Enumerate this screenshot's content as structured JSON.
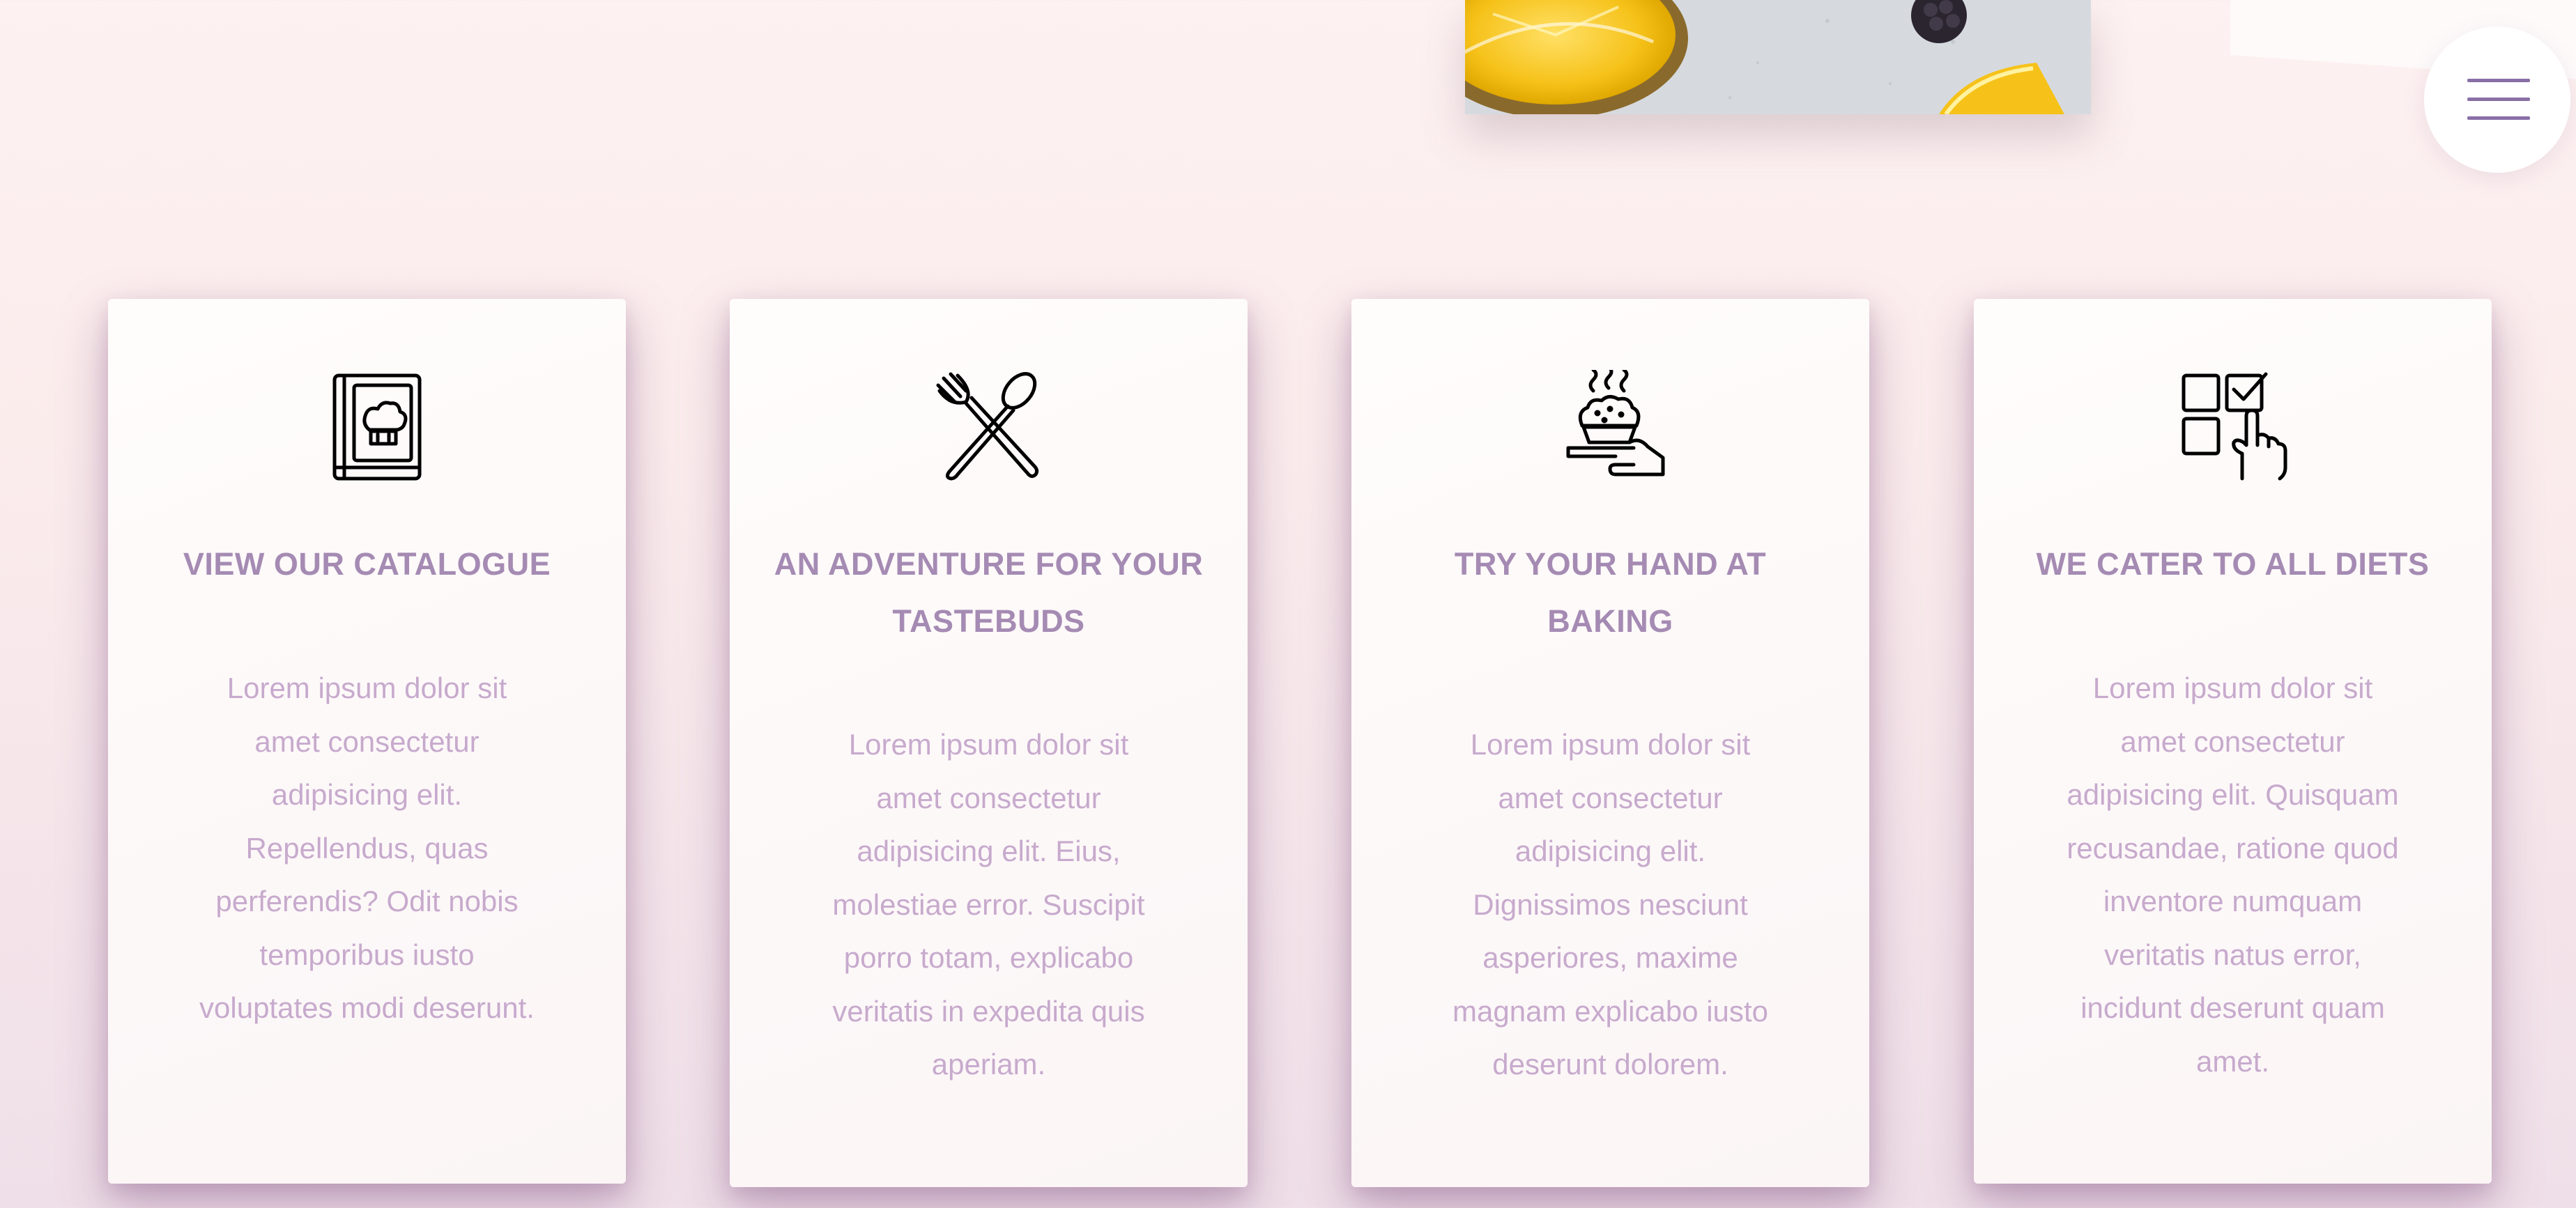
{
  "header": {
    "menu_icon": "hamburger-menu-icon",
    "accent_color": "#8a6fa6"
  },
  "hero": {
    "image_desc": "food-photo-fragment"
  },
  "features": [
    {
      "icon": "chef-book-icon",
      "title": "VIEW OUR CATALOGUE",
      "description": "Lorem ipsum dolor sit amet consectetur adipisicing elit. Repellendus, quas perferendis? Odit nobis temporibus iusto voluptates modi deserunt."
    },
    {
      "icon": "fork-spoon-icon",
      "title": "AN ADVENTURE FOR YOUR TASTEBUDS",
      "description": "Lorem ipsum dolor sit amet consectetur adipisicing elit. Eius, molestiae error. Suscipit porro totam, explicabo veritatis in expedita quis aperiam."
    },
    {
      "icon": "baking-muffin-icon",
      "title": "TRY YOUR HAND AT BAKING",
      "description": "Lorem ipsum dolor sit amet consectetur adipisicing elit. Dignissimos nesciunt asperiores, maxime magnam explicabo iusto deserunt dolorem."
    },
    {
      "icon": "diet-checklist-icon",
      "title": "WE CATER TO ALL DIETS",
      "description": "Lorem ipsum dolor sit amet consectetur adipisicing elit. Quisquam recusandae, ratione quod inventore numquam veritatis natus error, incidunt deserunt quam amet."
    }
  ],
  "colors": {
    "title": "#a58bb3",
    "body_text": "#c7aacd",
    "background": "#fbecec"
  }
}
